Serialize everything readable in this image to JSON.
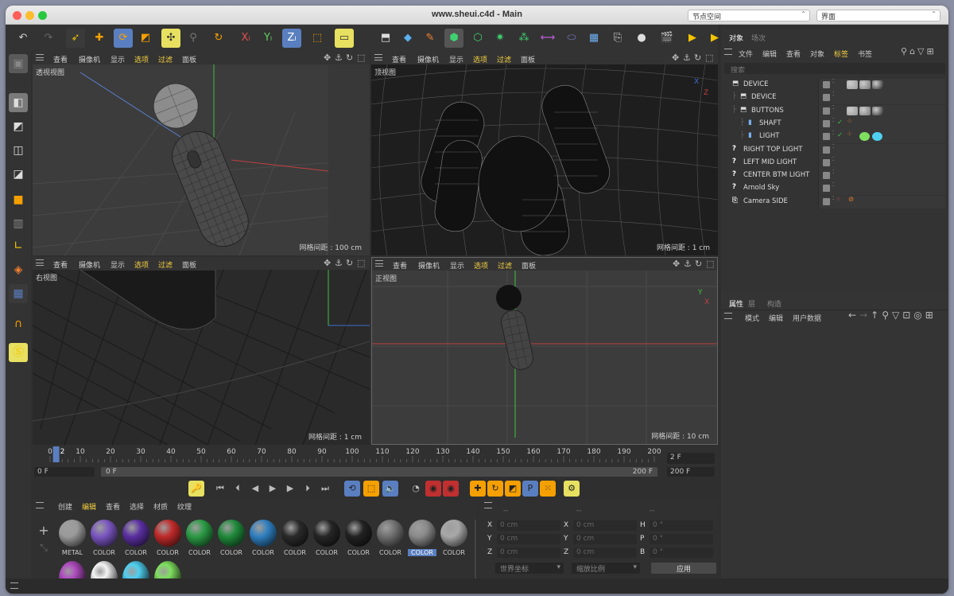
{
  "window": {
    "title": "www.sheui.c4d - Main",
    "node_space": "节点空间",
    "layout": "界面"
  },
  "colors": {
    "accent": "#f5c400",
    "selected_blue": "#5a7fc0",
    "x_axis": "#d04040",
    "y_axis": "#40c040",
    "z_axis": "#4060d0"
  },
  "toolbar": {
    "items": [
      "undo-icon",
      "redo-icon",
      "select-icon",
      "move-icon",
      "rotate-icon",
      "scale-icon",
      "transform-icon",
      "snap-icon",
      "reset-icon",
      "x-axis-icon",
      "y-axis-icon",
      "z-axis-icon",
      "coord-icon",
      "render-region-icon",
      "null-icon",
      "cube-icon",
      "pen-icon",
      "subdivision-icon",
      "extrude-icon",
      "volume-icon",
      "cloner-icon",
      "deformer-icon",
      "capsule-icon",
      "floor-icon",
      "camera-icon",
      "light-icon",
      "render-view-icon",
      "render-icon",
      "render-settings-icon"
    ]
  },
  "viewports": [
    {
      "label": "透视视图",
      "grid": "网格间距 : 100 cm",
      "menus": [
        "查看",
        "摄像机",
        "显示",
        "选项",
        "过滤",
        "面板"
      ]
    },
    {
      "label": "顶视图",
      "grid": "网格间距 : 1 cm",
      "menus": [
        "查看",
        "摄像机",
        "显示",
        "选项",
        "过滤",
        "面板"
      ]
    },
    {
      "label": "右视图",
      "grid": "网格间距 : 1 cm",
      "menus": [
        "查看",
        "摄像机",
        "显示",
        "选项",
        "过滤",
        "面板"
      ]
    },
    {
      "label": "正视图",
      "grid": "网格间距 : 10 cm",
      "menus": [
        "查看",
        "摄像机",
        "显示",
        "选项",
        "过滤",
        "面板"
      ]
    }
  ],
  "timeline": {
    "ticks": [
      "0",
      "10",
      "20",
      "30",
      "40",
      "50",
      "60",
      "70",
      "80",
      "90",
      "100",
      "110",
      "120",
      "130",
      "140",
      "150",
      "160",
      "170",
      "180",
      "190",
      "200"
    ],
    "current": "2",
    "frame_field": "2 F",
    "start": "0 F",
    "start2": "0 F",
    "end": "200 F",
    "end2": "200 F"
  },
  "materials": {
    "menus": [
      "创建",
      "编辑",
      "查看",
      "选择",
      "材质",
      "纹理"
    ],
    "row1": [
      {
        "label": "METAL",
        "color": "#9a9a9a"
      },
      {
        "label": "COLOR",
        "color": "#7a55c0"
      },
      {
        "label": "COLOR",
        "color": "#5a2fa0"
      },
      {
        "label": "COLOR",
        "color": "#c02a2a"
      },
      {
        "label": "COLOR",
        "color": "#2a9a44"
      },
      {
        "label": "COLOR",
        "color": "#1f8a3a"
      },
      {
        "label": "COLOR",
        "color": "#2f7fc0"
      },
      {
        "label": "COLOR",
        "color": "#2a2a2a"
      },
      {
        "label": "COLOR",
        "color": "#262626"
      },
      {
        "label": "COLOR",
        "color": "#222222"
      },
      {
        "label": "COLOR",
        "color": "#707070"
      },
      {
        "label": "COLOR",
        "color": "#8a8a8a"
      },
      {
        "label": "COLOR",
        "color": "#a8a8a8"
      }
    ],
    "row2": [
      "#b04dc0",
      "#f4f4f4",
      "#4fd0f0",
      "#7fe060"
    ],
    "selected_index": 11
  },
  "coords": {
    "head": [
      "--",
      "--",
      "--"
    ],
    "rows": [
      {
        "a": "X",
        "av": "0 cm",
        "b": "X",
        "bv": "0 cm",
        "c": "H",
        "cv": "0 °"
      },
      {
        "a": "Y",
        "av": "0 cm",
        "b": "Y",
        "bv": "0 cm",
        "c": "P",
        "cv": "0 °"
      },
      {
        "a": "Z",
        "av": "0 cm",
        "b": "Z",
        "bv": "0 cm",
        "c": "B",
        "cv": "0 °"
      }
    ],
    "world": "世界坐标",
    "scale": "缩放比例",
    "apply": "应用"
  },
  "objects": {
    "tabs": [
      "对象",
      "场次"
    ],
    "menus": [
      "文件",
      "编辑",
      "查看",
      "对象",
      "标签",
      "书签"
    ],
    "search": "搜索",
    "items": [
      {
        "name": "DEVICE",
        "indent": 0,
        "type": "null"
      },
      {
        "name": "DEVICE",
        "indent": 1,
        "type": "null"
      },
      {
        "name": "BUTTONS",
        "indent": 1,
        "type": "null"
      },
      {
        "name": "SHAFT",
        "indent": 2,
        "type": "obj"
      },
      {
        "name": "LIGHT",
        "indent": 2,
        "type": "obj"
      },
      {
        "name": "RIGHT TOP LIGHT",
        "indent": 0,
        "type": "unknown"
      },
      {
        "name": "LEFT MID LIGHT",
        "indent": 0,
        "type": "unknown"
      },
      {
        "name": "CENTER BTM LIGHT",
        "indent": 0,
        "type": "unknown"
      },
      {
        "name": "Arnold Sky",
        "indent": 0,
        "type": "unknown"
      },
      {
        "name": "Camera SIDE",
        "indent": 0,
        "type": "camera"
      }
    ]
  },
  "attributes": {
    "tabs": [
      "属性",
      "层",
      "构造"
    ],
    "menus": [
      "模式",
      "编辑",
      "用户数据"
    ]
  }
}
